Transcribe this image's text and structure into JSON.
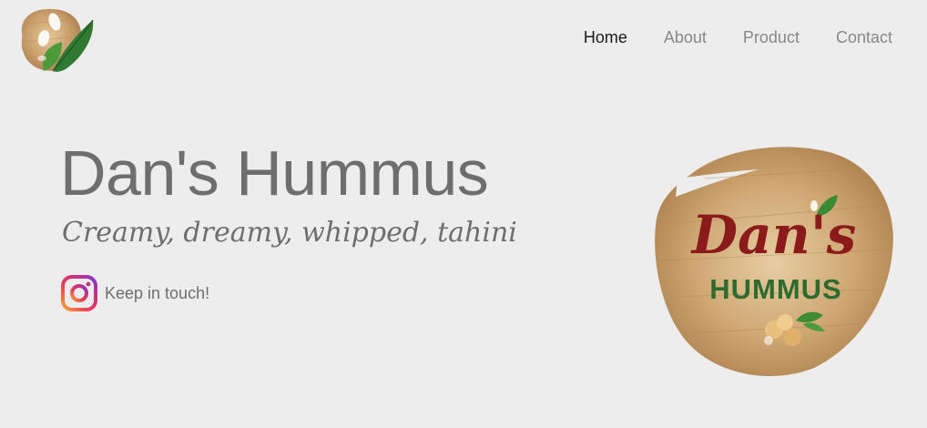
{
  "nav": {
    "items": [
      {
        "label": "Home",
        "active": true
      },
      {
        "label": "About",
        "active": false
      },
      {
        "label": "Product",
        "active": false
      },
      {
        "label": "Contact",
        "active": false
      }
    ]
  },
  "hero": {
    "title": "Dan's Hummus",
    "tagline": "Creamy, dreamy, whipped, tahini",
    "social_text": "Keep in touch!",
    "social_icon": "instagram-icon"
  },
  "badge": {
    "brand_line1": "Dan's",
    "brand_line2": "HUMMUS"
  },
  "colors": {
    "background": "#ededed",
    "nav_active": "#1a1a1a",
    "nav_inactive": "#888888",
    "text_gray": "#6e6e6e",
    "brand_red": "#8b1a1a",
    "brand_green": "#2e6b2e",
    "wood": "#c9a472"
  }
}
